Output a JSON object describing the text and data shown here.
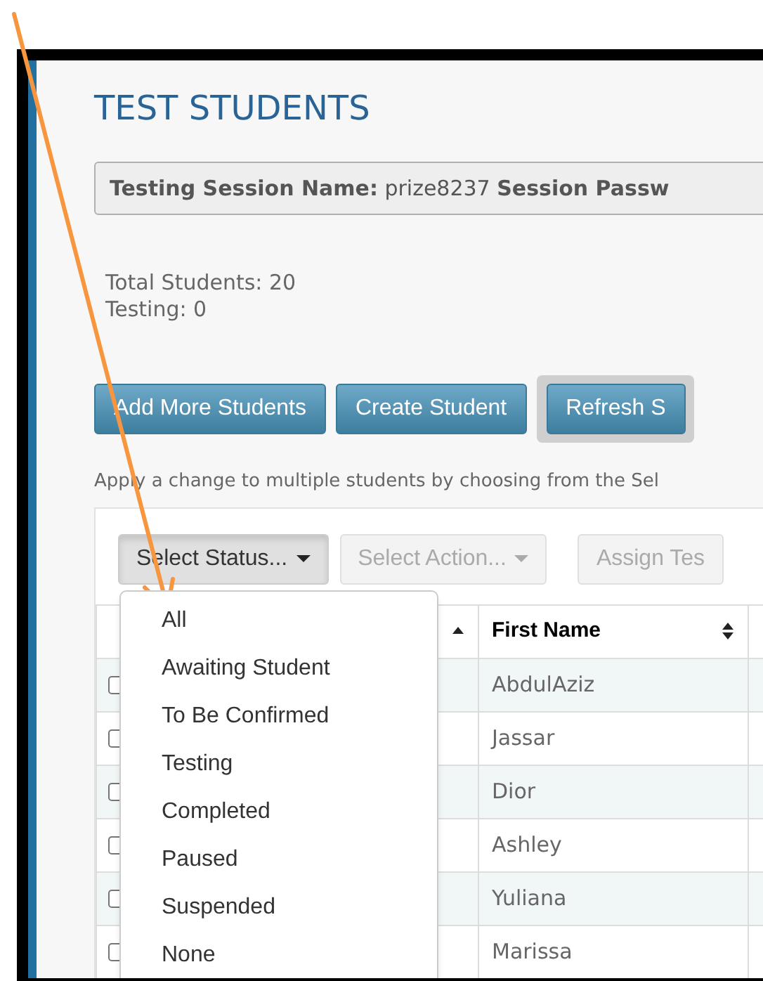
{
  "page": {
    "title": "TEST STUDENTS",
    "session_bar": "**Testing Session Name:** prize8237 **Session Passw**",
    "counts": [
      "Total Students: 20",
      "Testing: 0"
    ],
    "buttons": [
      {
        "label": "Add More Students",
        "kind": "plain"
      },
      {
        "label": "Create Student",
        "kind": "plain"
      },
      {
        "label": "Refresh S",
        "kind": "framed"
      }
    ],
    "help_text": "Apply a change to multiple students by choosing from the Sel",
    "toolbar": [
      {
        "label": "Select Status...",
        "kind": "dropdown",
        "disabled": false,
        "expanded": true
      },
      {
        "label": "Select Action...",
        "kind": "dropdown",
        "disabled": true,
        "expanded": false
      },
      {
        "label": "Assign Tes",
        "kind": "button",
        "disabled": true,
        "expanded": false
      }
    ],
    "status_menu": [
      "All",
      "Awaiting Student",
      "To Be Confirmed",
      "Testing",
      "Completed",
      "Paused",
      "Suspended",
      "None"
    ],
    "table": {
      "columns": [
        {
          "kind": "sorted"
        },
        {
          "label": "First Name",
          "kind": "sortable"
        }
      ],
      "rows": [
        {
          "checked": false,
          "first_name": "AbdulAziz"
        },
        {
          "checked": false,
          "first_name": "Jassar"
        },
        {
          "checked": false,
          "first_name": "Dior"
        },
        {
          "checked": false,
          "first_name": "Ashley"
        },
        {
          "checked": false,
          "first_name": "Yuliana"
        },
        {
          "checked": false,
          "first_name": "Marissa"
        }
      ]
    }
  }
}
